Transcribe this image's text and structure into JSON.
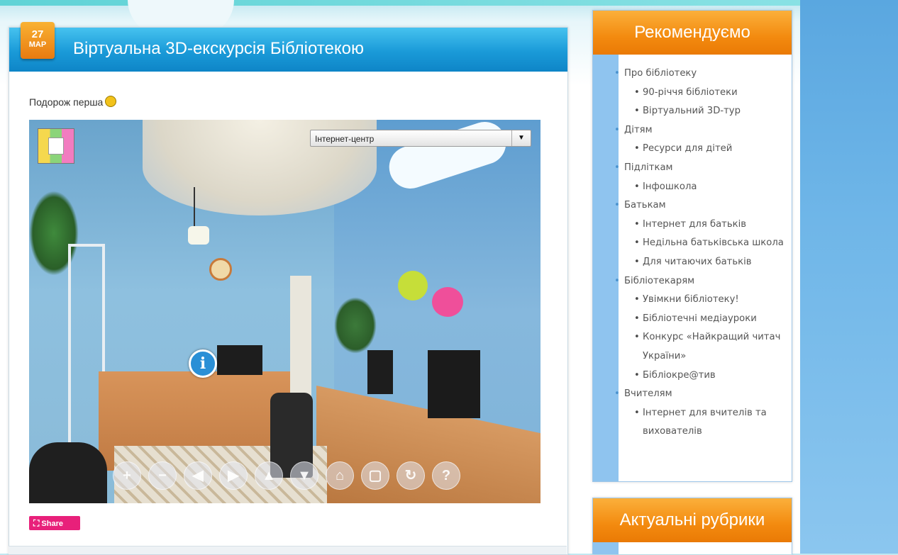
{
  "post": {
    "date_day": "27",
    "date_month": "МАР",
    "title": "Віртуальна 3D-екскурсія Бібліотекою",
    "intro": "Подорож перша",
    "viewer": {
      "scene_select_value": "Інтернет-центр",
      "hotspot_label": "i",
      "controls": [
        {
          "name": "zoom-in",
          "icon": "plus-icon",
          "glyph": "+"
        },
        {
          "name": "zoom-out",
          "icon": "minus-icon",
          "glyph": "−"
        },
        {
          "name": "pan-left",
          "icon": "arrow-left-icon",
          "glyph": "◀"
        },
        {
          "name": "pan-right",
          "icon": "arrow-right-icon",
          "glyph": "▶"
        },
        {
          "name": "pan-up",
          "icon": "arrow-up-icon",
          "glyph": "▲"
        },
        {
          "name": "pan-down",
          "icon": "arrow-down-icon",
          "glyph": "▼"
        },
        {
          "name": "home",
          "icon": "home-icon",
          "glyph": "⌂"
        },
        {
          "name": "fullscreen",
          "icon": "fullscreen-icon",
          "glyph": "▢"
        },
        {
          "name": "autorotate",
          "icon": "rotate-icon",
          "glyph": "↻"
        },
        {
          "name": "help",
          "icon": "help-icon",
          "glyph": "?"
        }
      ]
    },
    "share_label": "Share"
  },
  "sidebar": {
    "recommend": {
      "title": "Рекомендуємо",
      "items": [
        {
          "label": "Про бібліотеку",
          "level": 1
        },
        {
          "label": "90-річчя бібліотеки",
          "level": 2
        },
        {
          "label": "Віртуальний 3D-тур",
          "level": 2
        },
        {
          "label": "Дітям",
          "level": 1
        },
        {
          "label": "Ресурси для дітей",
          "level": 2
        },
        {
          "label": "Підліткам",
          "level": 1
        },
        {
          "label": "Інфошкола",
          "level": 2
        },
        {
          "label": "Батькам",
          "level": 1
        },
        {
          "label": "Інтернет для батьків",
          "level": 2
        },
        {
          "label": "Недільна батьківська школа",
          "level": 2
        },
        {
          "label": "Для читаючих батьків",
          "level": 2
        },
        {
          "label": "Бібліотекарям",
          "level": 1
        },
        {
          "label": "Увімкни бібліотеку!",
          "level": 2
        },
        {
          "label": "Бібліотечні медіауроки",
          "level": 2
        },
        {
          "label": "Конкурс «Найкращий читач України»",
          "level": 2
        },
        {
          "label": "Бібліокре@тив",
          "level": 2
        },
        {
          "label": "Вчителям",
          "level": 1
        },
        {
          "label": "Інтернет для вчителів та вихователів",
          "level": 2
        }
      ]
    },
    "rubrics": {
      "title": "Актуальні рубрики"
    }
  },
  "colors": {
    "header_blue": "#1a9ad8",
    "widget_orange": "#f38a0f",
    "share_pink": "#e8207a",
    "sidebar_stripe": "#8fc4ef"
  }
}
